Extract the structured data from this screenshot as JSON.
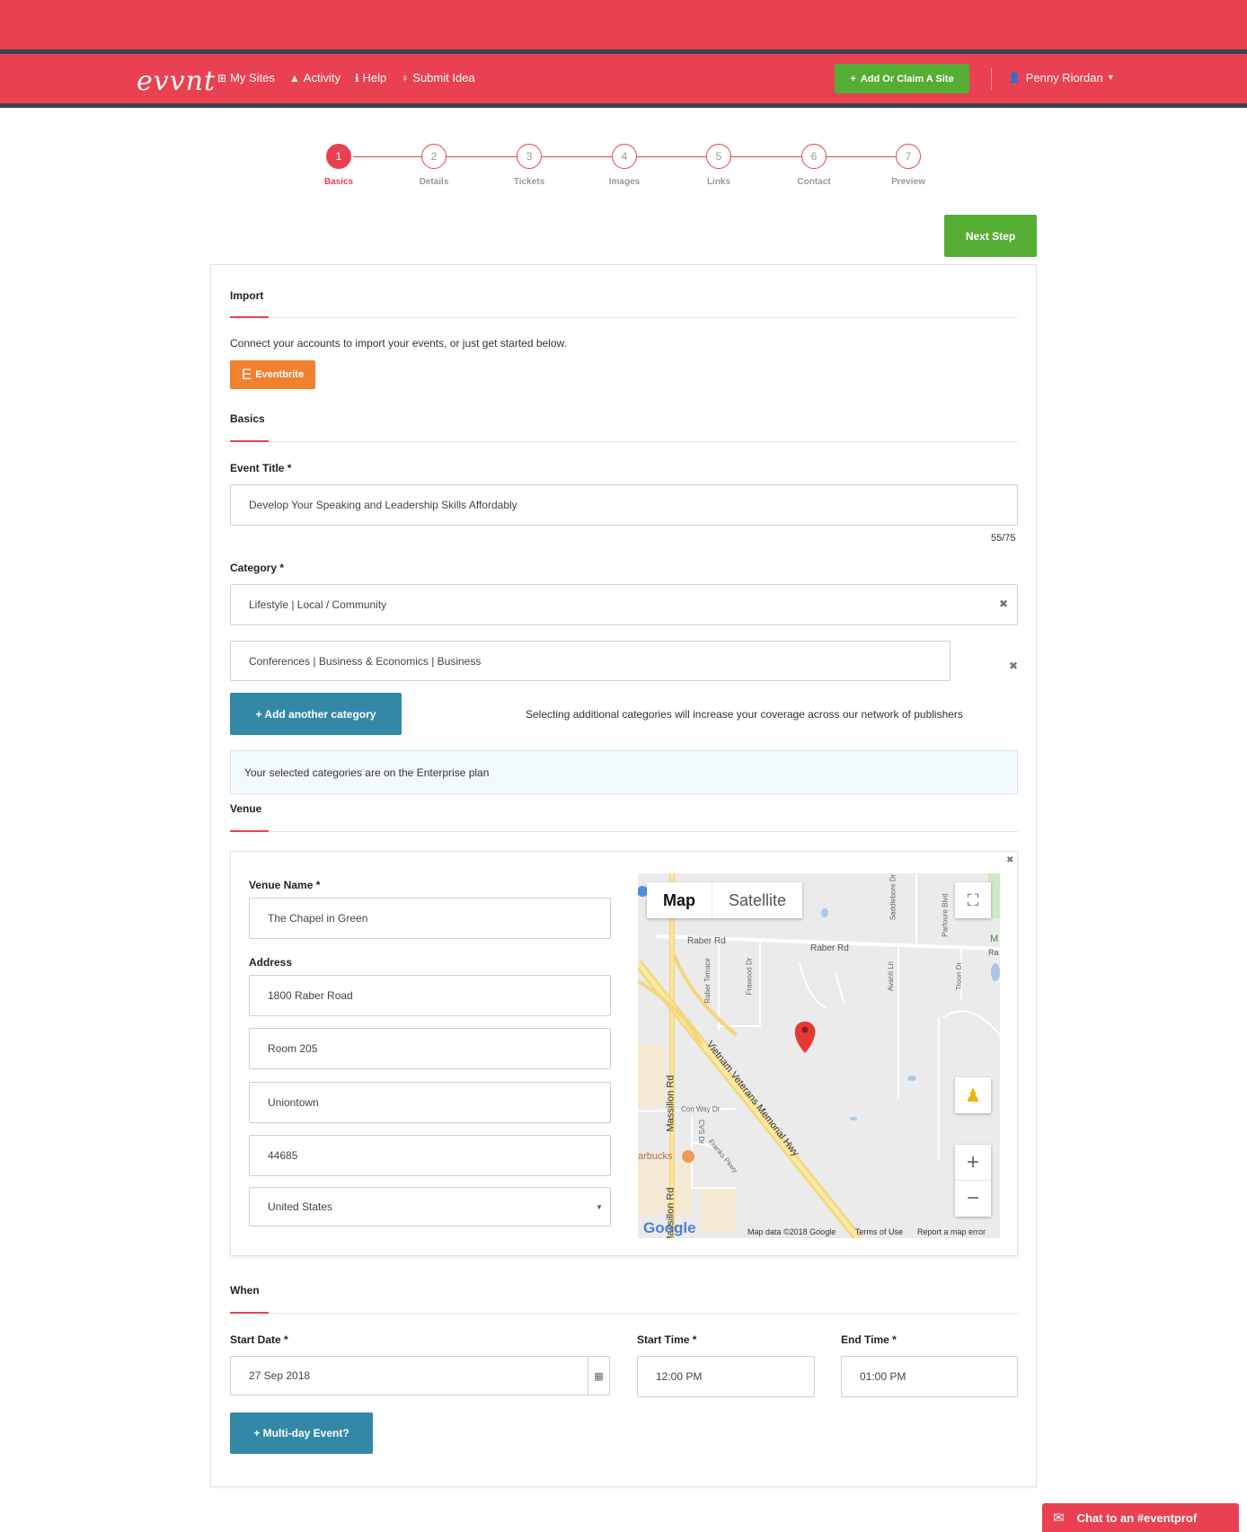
{
  "header": {
    "logo": "evvnt",
    "nav": [
      {
        "icon": "sitemap-icon",
        "glyph": "⊞",
        "label": "My Sites"
      },
      {
        "icon": "activity-chart-icon",
        "glyph": "▲",
        "label": "Activity"
      },
      {
        "icon": "info-icon",
        "glyph": "ℹ",
        "label": "Help"
      },
      {
        "icon": "lightbulb-icon",
        "glyph": "♀",
        "label": "Submit Idea"
      }
    ],
    "add_site": {
      "icon_glyph": "+",
      "label": "Add Or Claim A Site"
    },
    "user": {
      "icon_glyph": "👤",
      "name": "Penny Riordan",
      "caret": "▾"
    }
  },
  "steps": [
    {
      "num": "1",
      "label": "Basics",
      "active": true
    },
    {
      "num": "2",
      "label": "Details",
      "active": false
    },
    {
      "num": "3",
      "label": "Tickets",
      "active": false
    },
    {
      "num": "4",
      "label": "Images",
      "active": false
    },
    {
      "num": "5",
      "label": "Links",
      "active": false
    },
    {
      "num": "6",
      "label": "Contact",
      "active": false
    },
    {
      "num": "7",
      "label": "Preview",
      "active": false
    }
  ],
  "next_step": "Next Step",
  "import": {
    "title": "Import",
    "desc": "Connect your accounts to import your events, or just get started below.",
    "eventbrite": {
      "glyph": "E",
      "label": "Eventbrite"
    }
  },
  "basics": {
    "title": "Basics",
    "event_title_label": "Event Title *",
    "event_title_value": "Develop Your Speaking and Leadership Skills Affordably",
    "char_count": "55/75",
    "category_label": "Category *",
    "category_1": "Lifestyle | Local / Community",
    "category_2": "Conferences | Business & Economics | Business",
    "clear_glyph": "✖",
    "add_category": "+ Add another category",
    "coverage_note": "Selecting additional categories will increase your coverage across our network of publishers",
    "plan_note": "Your selected categories are on the Enterprise plan"
  },
  "venue": {
    "title": "Venue",
    "name_label": "Venue Name *",
    "name_value": "The Chapel in Green",
    "address_label": "Address",
    "address_1": "1800 Raber Road",
    "address_2": "Room 205",
    "city": "Uniontown",
    "zip": "44685",
    "country": "United States",
    "close_glyph": "✖",
    "map": {
      "type_map": "Map",
      "type_satellite": "Satellite",
      "streets": {
        "raber_rd_1": "Raber Rd",
        "raber_rd_2": "Raber Rd",
        "raber_terrace": "Raber Terrace",
        "frawood": "Frawood Dr",
        "avanti": "Avanti Ln",
        "troon": "Troon Dr",
        "saddlebore": "Saddlebore Dr",
        "parfoure": "Parfoure Blvd",
        "massillon_1": "Massillon Rd",
        "massillon_2": "Massillon Rd",
        "vietnam": "Vietnam Veterans Memorial Hwy",
        "con_way": "Con Way Dr",
        "cvs": "CVS Dr",
        "franks": "Franks Pkwy",
        "starbucks": "arbucks",
        "edge_m": "M",
        "edge_ra": "Ra"
      },
      "google": "Google",
      "map_data": "Map data ©2018 Google",
      "terms": "Terms of Use",
      "report": "Report a map error",
      "zoom_in": "+",
      "zoom_out": "−"
    }
  },
  "when": {
    "title": "When",
    "start_date_label": "Start Date *",
    "start_date": "27 Sep 2018",
    "start_time_label": "Start Time *",
    "start_time": "12:00 PM",
    "end_time_label": "End Time *",
    "end_time": "01:00 PM",
    "multi_day": "+ Multi-day Event?"
  },
  "chat": {
    "icon_glyph": "✉",
    "label": "Chat to an #eventprof"
  },
  "colors": {
    "brand": "#e94152",
    "green": "#56ad34",
    "blue": "#3388a8",
    "orange": "#f0812f"
  }
}
